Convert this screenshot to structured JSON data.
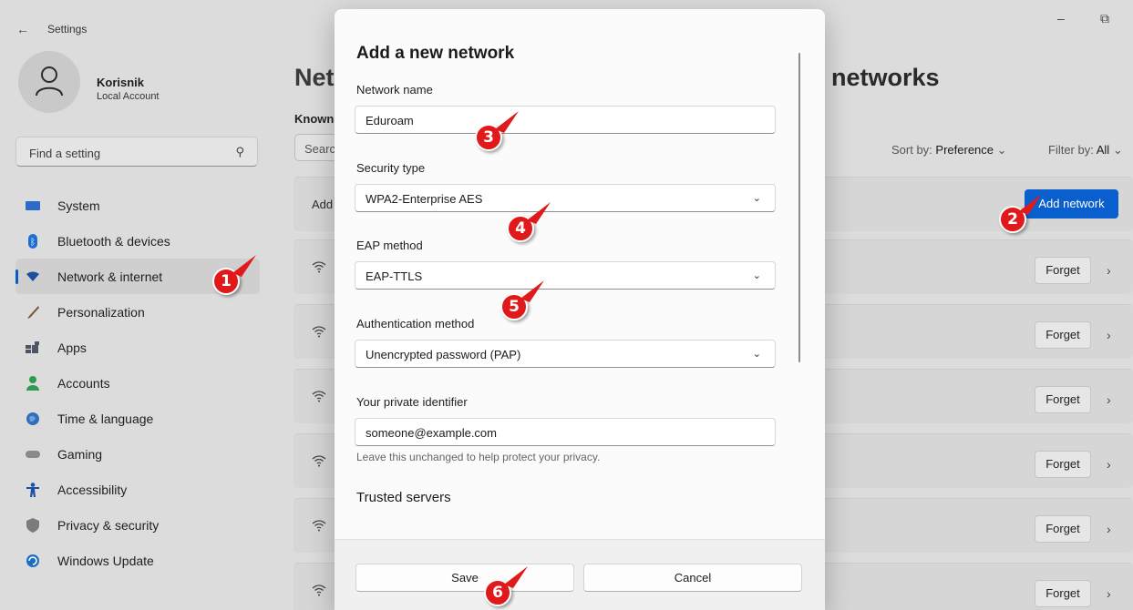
{
  "window": {
    "title": "Settings",
    "back_icon": "back-arrow-icon",
    "minimize": "–",
    "restore": "⧉"
  },
  "profile": {
    "name": "Korisnik",
    "account_type": "Local Account"
  },
  "search": {
    "placeholder": "Find a setting"
  },
  "sidebar": {
    "items": [
      {
        "label": "System",
        "icon": "system-icon",
        "active": false
      },
      {
        "label": "Bluetooth & devices",
        "icon": "bluetooth-icon",
        "active": false
      },
      {
        "label": "Network & internet",
        "icon": "network-icon",
        "active": true
      },
      {
        "label": "Personalization",
        "icon": "brush-icon",
        "active": false
      },
      {
        "label": "Apps",
        "icon": "apps-icon",
        "active": false
      },
      {
        "label": "Accounts",
        "icon": "accounts-icon",
        "active": false
      },
      {
        "label": "Time & language",
        "icon": "globe-icon",
        "active": false
      },
      {
        "label": "Gaming",
        "icon": "gamepad-icon",
        "active": false
      },
      {
        "label": "Accessibility",
        "icon": "accessibility-icon",
        "active": false
      },
      {
        "label": "Privacy & security",
        "icon": "shield-icon",
        "active": false
      },
      {
        "label": "Windows Update",
        "icon": "update-icon",
        "active": false
      }
    ]
  },
  "main": {
    "heading_left": "Net",
    "heading_right": "networks",
    "known_label": "Known",
    "search_placeholder": "Searc",
    "sort_label": "Sort by:",
    "sort_value": "Preference",
    "filter_label": "Filter by:",
    "filter_value": "All",
    "add_row_label": "Add",
    "add_network_button": "Add network",
    "forget_label": "Forget"
  },
  "dialog": {
    "title": "Add a new network",
    "network_name_label": "Network name",
    "network_name_value": "Eduroam",
    "security_type_label": "Security type",
    "security_type_value": "WPA2-Enterprise AES",
    "eap_method_label": "EAP method",
    "eap_method_value": "EAP-TTLS",
    "auth_method_label": "Authentication method",
    "auth_method_value": "Unencrypted password (PAP)",
    "private_id_label": "Your private identifier",
    "private_id_value": "someone@example.com",
    "private_id_help": "Leave this unchanged to help protect your privacy.",
    "trusted_servers_label": "Trusted servers",
    "save_button": "Save",
    "cancel_button": "Cancel"
  },
  "markers": [
    "1",
    "2",
    "3",
    "4",
    "5",
    "6"
  ],
  "colors": {
    "accent": "#0a5fcf",
    "marker": "#e0191b"
  }
}
